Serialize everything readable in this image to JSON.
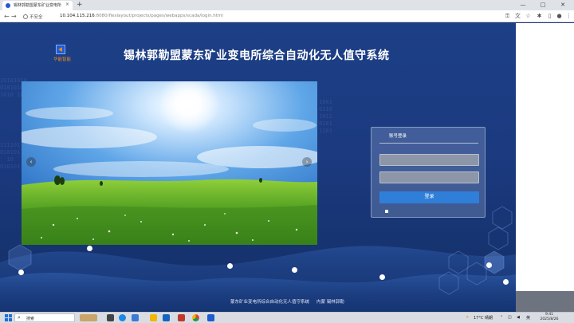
{
  "browser": {
    "tab_title": "锡林郭勒盟蒙东矿业变电所综合",
    "tab_close": "×",
    "new_tab": "+",
    "security_label": "不安全",
    "url_host": "10.104.115.216",
    "url_path": ":8080/flexlayout/projects/pages/webapps/scada/login.html",
    "nav": {
      "back": "←",
      "forward": "→",
      "reload": "↻"
    },
    "toolbar_icons": [
      "key-icon",
      "translate-icon",
      "star-icon",
      "extensions-icon",
      "sidebar-icon",
      "profile-icon",
      "menu-icon"
    ]
  },
  "page": {
    "logo_text": "华能智能",
    "title": "锡林郭勒盟蒙东矿业变电所综合自动化无人值守系统",
    "carousel": {
      "prev": "‹",
      "next": "›"
    },
    "login": {
      "tab_label": "账号登录",
      "username_placeholder": "",
      "password_placeholder": "",
      "button_label": "登录"
    },
    "footer": {
      "left": "蒙东矿业变电所综合自动化无人值守系统",
      "right": "内蒙 锡林郭勒"
    }
  },
  "taskbar": {
    "search_placeholder": "搜索",
    "weather": "17°C 晴朗",
    "ime": "英",
    "time": "9:41",
    "date": "2025/8/26"
  }
}
